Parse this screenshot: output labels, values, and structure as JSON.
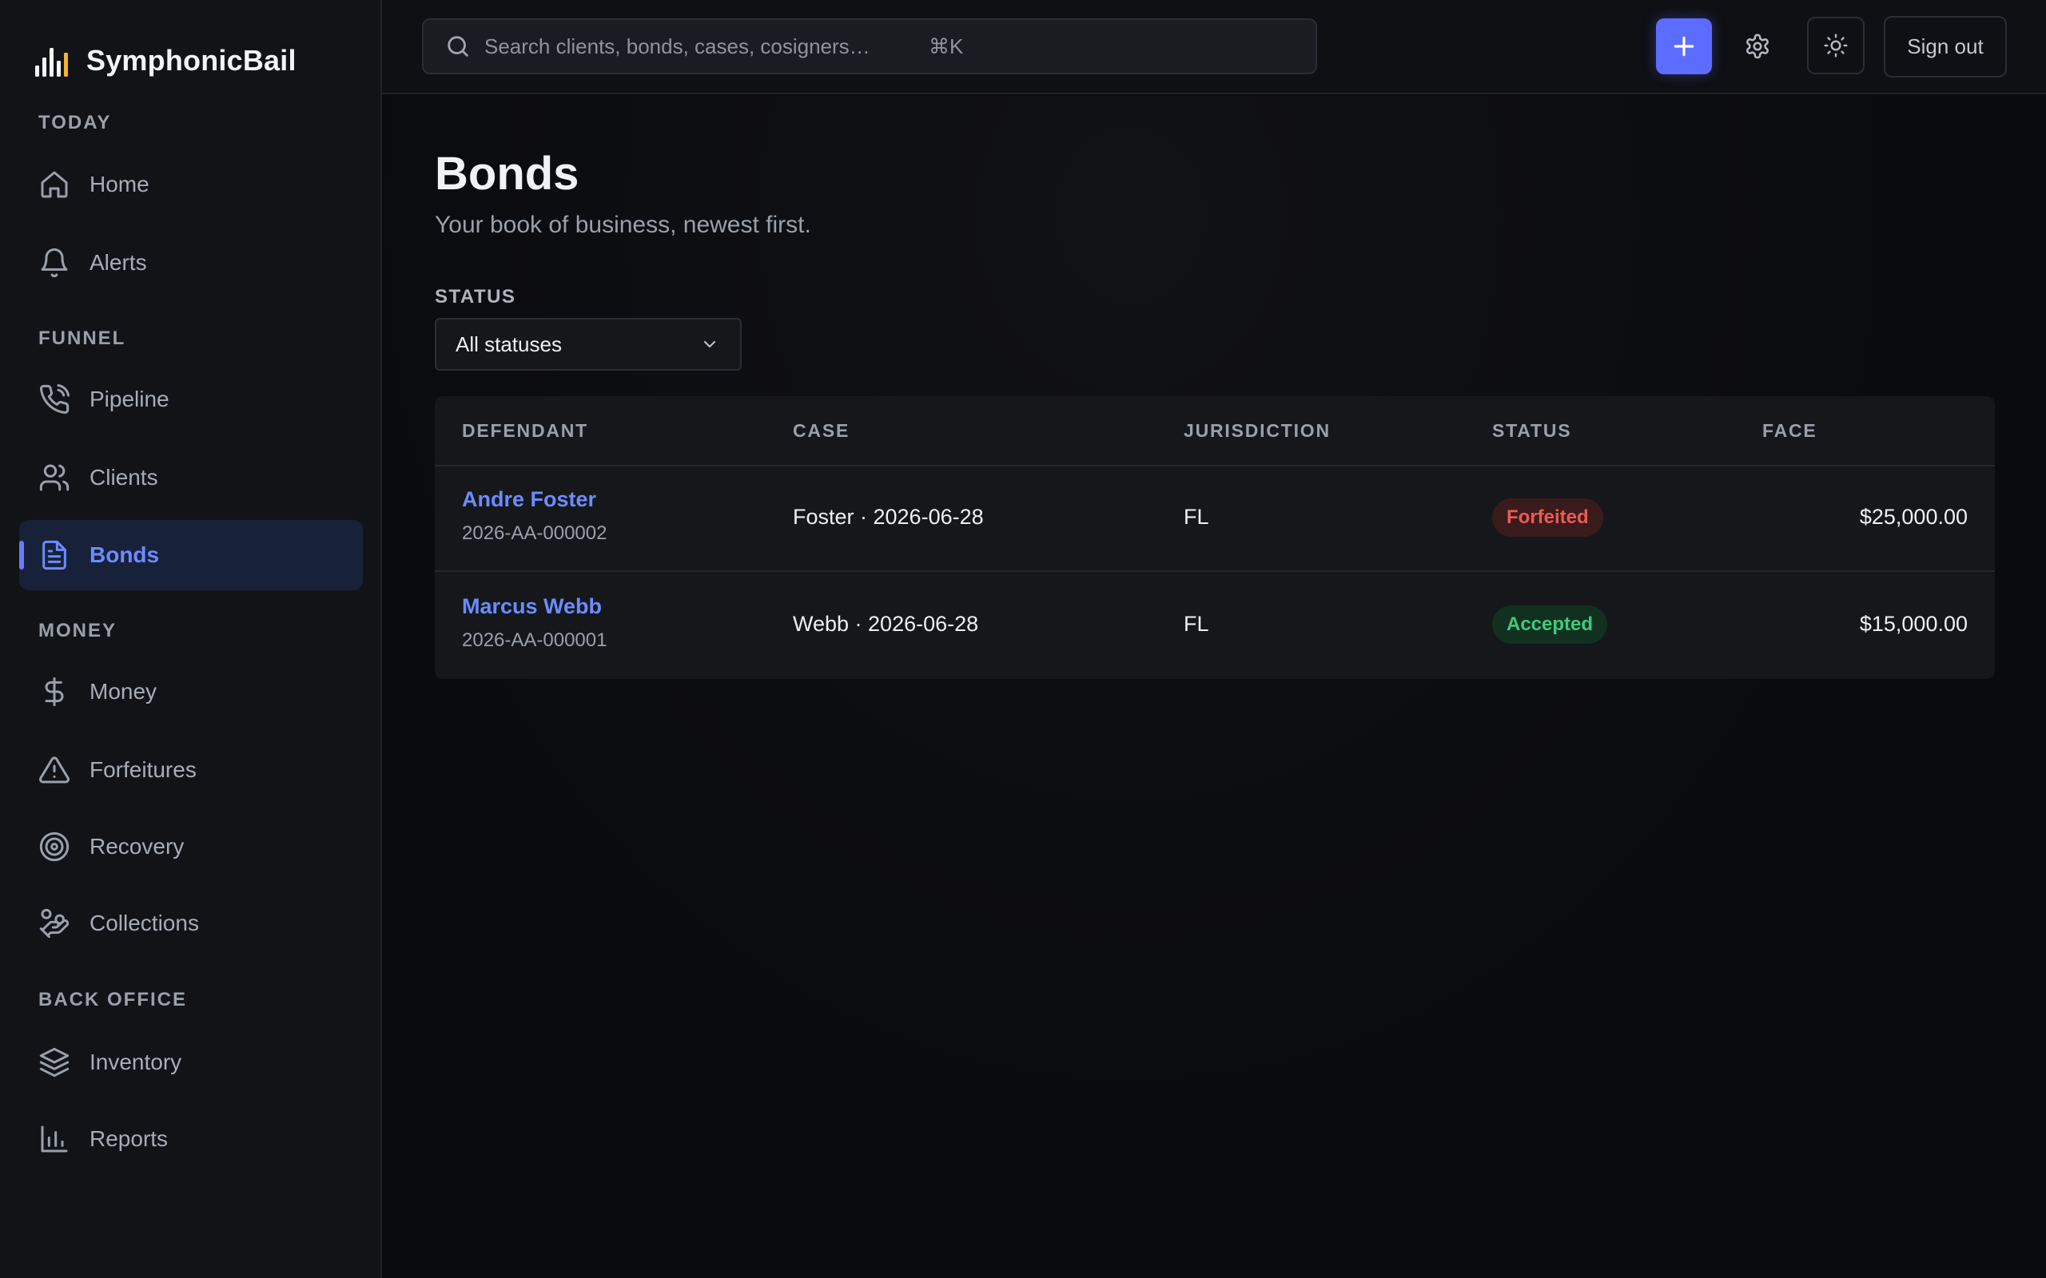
{
  "app": {
    "name": "SymphonicBail"
  },
  "sidebar": {
    "sections": [
      {
        "label": "TODAY"
      },
      {
        "label": "FUNNEL"
      },
      {
        "label": "MONEY"
      },
      {
        "label": "BACK OFFICE"
      }
    ],
    "items": [
      {
        "label": "Home",
        "icon": "home-icon"
      },
      {
        "label": "Alerts",
        "icon": "bell-icon"
      },
      {
        "label": "Pipeline",
        "icon": "phone-icon"
      },
      {
        "label": "Clients",
        "icon": "users-icon"
      },
      {
        "label": "Bonds",
        "icon": "document-icon",
        "active": true
      },
      {
        "label": "Money",
        "icon": "dollar-icon"
      },
      {
        "label": "Forfeitures",
        "icon": "warning-icon"
      },
      {
        "label": "Recovery",
        "icon": "target-icon"
      },
      {
        "label": "Collections",
        "icon": "hand-coins-icon"
      },
      {
        "label": "Inventory",
        "icon": "layers-icon"
      },
      {
        "label": "Reports",
        "icon": "bar-chart-icon"
      }
    ]
  },
  "topbar": {
    "search_placeholder": "Search clients, bonds, cases, cosigners…",
    "search_shortcut": "⌘K",
    "signout_label": "Sign out"
  },
  "page": {
    "title": "Bonds",
    "subtitle": "Your book of business, newest first."
  },
  "filter": {
    "label": "STATUS",
    "selected": "All statuses"
  },
  "table": {
    "columns": [
      "DEFENDANT",
      "CASE",
      "JURISDICTION",
      "STATUS",
      "FACE"
    ],
    "rows": [
      {
        "defendant": "Andre Foster",
        "bond_id": "2026-AA-000002",
        "case": "Foster · 2026-06-28",
        "jurisdiction": "FL",
        "status": "Forfeited",
        "face": "$25,000.00"
      },
      {
        "defendant": "Marcus Webb",
        "bond_id": "2026-AA-000001",
        "case": "Webb · 2026-06-28",
        "jurisdiction": "FL",
        "status": "Accepted",
        "face": "$15,000.00"
      }
    ]
  },
  "colors": {
    "accent": "#5b6cff",
    "link": "#6b8cff",
    "forfeited": "#ef5a52",
    "accepted": "#3ecb7c",
    "logo_gold": "#f2b233"
  }
}
